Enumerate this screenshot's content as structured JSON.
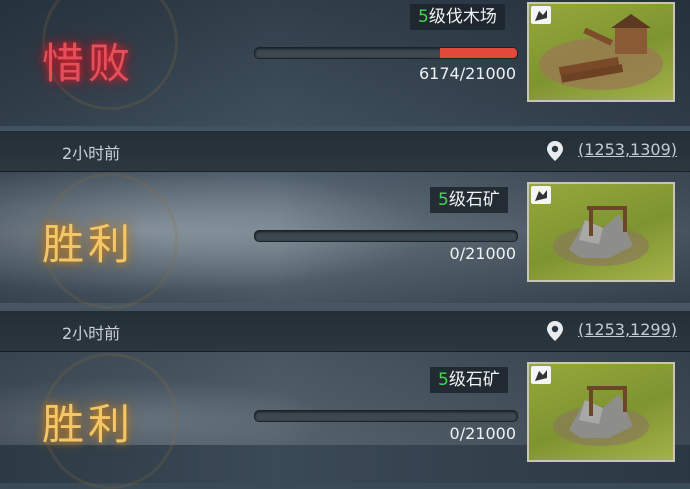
{
  "reports": [
    {
      "time": "",
      "coord": "",
      "result": "惜败",
      "target_level": "5",
      "target_name": "级伐木场",
      "progress_text": "6174/21000",
      "progress_fraction": 0.294
    },
    {
      "time": "2小时前",
      "coord": "(1253,1309)",
      "result": "胜利",
      "target_level": "5",
      "target_name": "级石矿",
      "progress_text": "0/21000",
      "progress_fraction": 0
    },
    {
      "time": "2小时前",
      "coord": "(1253,1299)",
      "result": "胜利",
      "target_level": "5",
      "target_name": "级石矿",
      "progress_text": "0/21000",
      "progress_fraction": 0
    }
  ],
  "icons": {
    "location": "map-pin-icon",
    "thumb_tag": "white-flag-icon",
    "lumber": "lumber-mill-icon",
    "quarry": "stone-quarry-icon"
  },
  "colors": {
    "defeat": "#e4505a",
    "victory": "#f3c668",
    "level": "#3ed94a",
    "progress_fill": "#e04a3a"
  }
}
